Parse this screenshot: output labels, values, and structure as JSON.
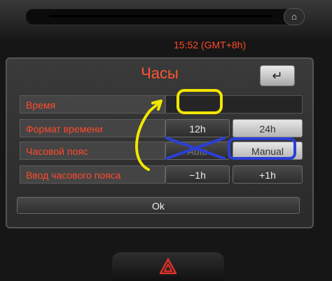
{
  "screen": {
    "title": "Часы",
    "back_label": "↵"
  },
  "rows": {
    "time_label": "Время",
    "time_value": "15:52 (GMT+8h)",
    "format_label": "Формат времени",
    "format_12": "12h",
    "format_24": "24h",
    "tz_label": "Часовой пояс",
    "tz_auto": "Auto",
    "tz_manual": "Manual",
    "tz_input_label": "Ввод часового пояса",
    "tz_minus": "−1h",
    "tz_plus": "+1h"
  },
  "ok_label": "Ok",
  "hardware": {
    "home_icon": "⌂"
  },
  "colors": {
    "accent": "#ff4a2c",
    "highlight_yellow": "#f2e600",
    "highlight_blue": "#2b3fd6"
  }
}
